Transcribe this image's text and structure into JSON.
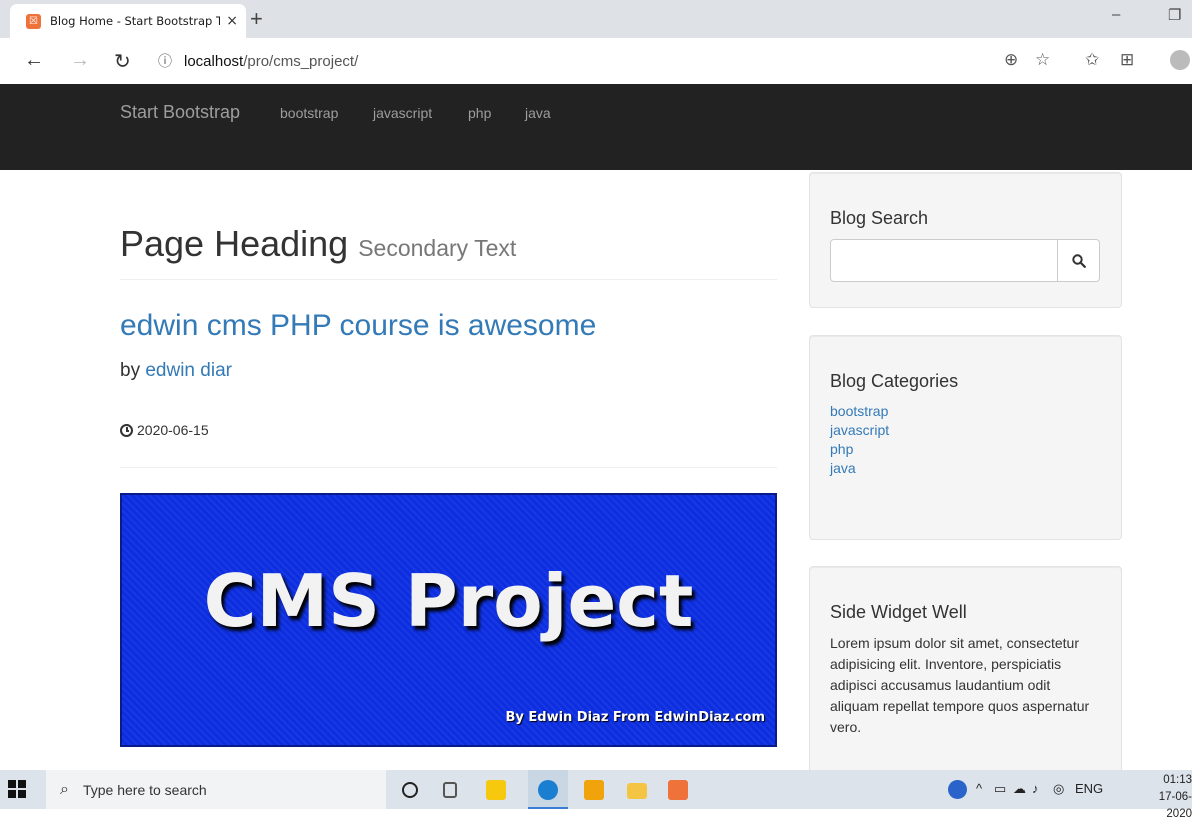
{
  "browser": {
    "tab_title": "Blog Home - Start Bootstrap Ten",
    "tab_close": "×",
    "new_tab": "+",
    "minimize": "–",
    "restore": "❐",
    "back": "←",
    "forward": "→",
    "reload": "↻",
    "info": "ⓘ",
    "url_host": "localhost",
    "url_path": "/pro/cms_project/",
    "zoom_icon": "⊕",
    "star_icon": "☆",
    "favorites_icon": "✩",
    "collections_icon": "⊞"
  },
  "navbar": {
    "brand": "Start Bootstrap",
    "links": [
      "bootstrap",
      "javascript",
      "php",
      "java"
    ]
  },
  "main": {
    "heading": "Page Heading",
    "heading_small": "Secondary Text",
    "post": {
      "title": "edwin cms PHP course is awesome",
      "by": "by",
      "author": "edwin diar",
      "date": "2020-06-15",
      "image_title": "CMS Project",
      "image_credit": "By Edwin Diaz From EdwinDiaz.com"
    }
  },
  "sidebar": {
    "search": {
      "title": "Blog Search",
      "placeholder": ""
    },
    "categories": {
      "title": "Blog Categories",
      "items": [
        "bootstrap",
        "javascript",
        "php",
        "java"
      ]
    },
    "widget": {
      "title": "Side Widget Well",
      "text": "Lorem ipsum dolor sit amet, consectetur adipisicing elit. Inventore, perspiciatis adipisci accusamus laudantium odit aliquam repellat tempore quos aspernatur vero."
    }
  },
  "taskbar": {
    "search_placeholder": "Type here to search",
    "lang": "ENG",
    "time": "01:13",
    "date": "17-06-2020"
  },
  "colors": {
    "link": "#337ab7",
    "navbar_bg": "#222222",
    "well_bg": "#f5f5f5",
    "image_bg": "#0c2ee0"
  }
}
